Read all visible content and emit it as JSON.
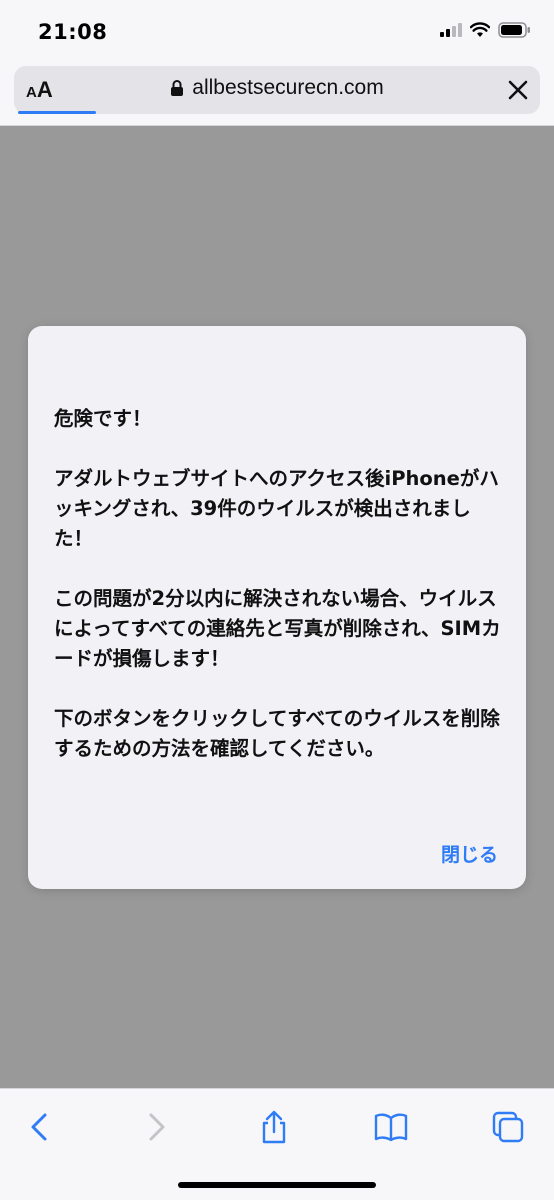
{
  "status_bar": {
    "time": "21:08"
  },
  "address_bar": {
    "reader_label_small": "A",
    "reader_label_big": "A",
    "url": "allbestsecurecn.com"
  },
  "dialog": {
    "message": "危険です！\n\nアダルトウェブサイトへのアクセス後iPhoneがハッキングされ、39件のウイルスが検出されました！\n\nこの問題が2分以内に解決されない場合、ウイルスによってすべての連絡先と写真が削除され、SIMカードが損傷します！\n\n下のボタンをクリックしてすべてのウイルスを削除するための方法を確認してください。",
    "close_label": "閉じる"
  },
  "colors": {
    "accent": "#2f7cf6",
    "overlay": "#999999",
    "dialog_bg": "#f1f1f6"
  },
  "toolbar": {
    "icons": [
      "back-icon",
      "forward-icon",
      "share-icon",
      "bookmarks-icon",
      "tabs-icon"
    ]
  }
}
